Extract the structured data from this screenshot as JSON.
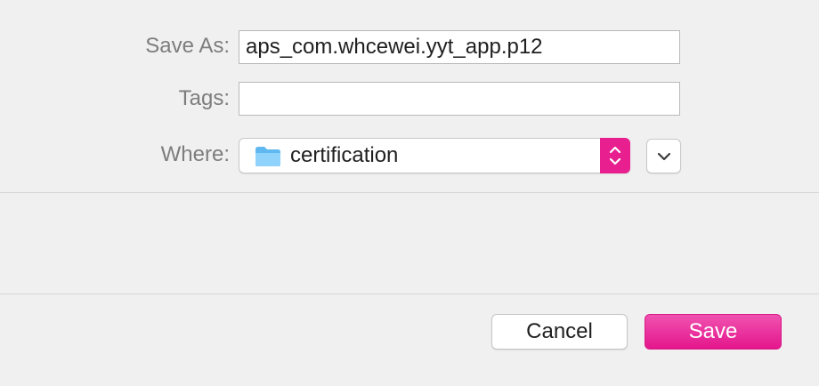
{
  "form": {
    "save_as_label": "Save As:",
    "save_as_value": "aps_com.whcewei.yyt_app.p12",
    "tags_label": "Tags:",
    "tags_value": "",
    "where_label": "Where:",
    "where_value": "certification",
    "where_icon": "folder-icon"
  },
  "buttons": {
    "cancel_label": "Cancel",
    "save_label": "Save"
  },
  "colors": {
    "accent": "#e8208f",
    "background": "#f0f0f0"
  }
}
